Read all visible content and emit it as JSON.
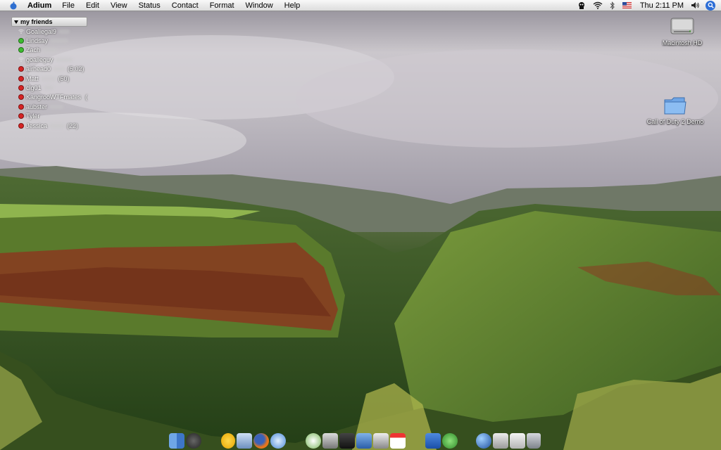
{
  "menubar": {
    "app_name": "Adium",
    "items": [
      "File",
      "Edit",
      "View",
      "Status",
      "Contact",
      "Format",
      "Window",
      "Help"
    ],
    "clock": "Thu 2:11 PM"
  },
  "buddy_list": {
    "group": "my friends",
    "buddies": [
      {
        "name": "Goaliegal9",
        "status": "mobile",
        "extra": ""
      },
      {
        "name": "Lindsay",
        "status": "available",
        "extra": ""
      },
      {
        "name": "Zach",
        "status": "available",
        "extra": ""
      },
      {
        "name": "goalleguy",
        "status": "mobile",
        "extra": ""
      },
      {
        "name": "airhead0",
        "status": "away",
        "extra": "(5:02)"
      },
      {
        "name": "Matt",
        "status": "away",
        "extra": "(50)"
      },
      {
        "name": "clg01",
        "status": "away",
        "extra": ""
      },
      {
        "name": "KangrooWTFmates",
        "status": "away",
        "extra": "("
      },
      {
        "name": "aubster",
        "status": "away",
        "extra": ""
      },
      {
        "name": "Tyler",
        "status": "away",
        "extra": ""
      },
      {
        "name": "Jessica",
        "status": "away",
        "extra": "(22)"
      }
    ]
  },
  "desktop_icons": [
    {
      "label": "Macintosh HD",
      "icon": "hard-drive-icon"
    },
    {
      "label": "Call of Duty 2 Demo",
      "icon": "folder-icon"
    }
  ],
  "dock_icons": [
    "finder-icon",
    "dashboard-icon",
    "aim-icon",
    "preview-icon",
    "firefox-icon",
    "safari-icon",
    "itunes-icon",
    "iphoto-icon",
    "imovie-icon",
    "idvd-icon",
    "garageband-icon",
    "ical-icon",
    "word-icon",
    "adium-icon",
    "google-earth-icon",
    "system-preferences-icon",
    "mail-icon",
    "trash-icon"
  ],
  "colors": {
    "available": "#3dbb2f",
    "away": "#d62323",
    "menubar": "#e8e8e8"
  }
}
